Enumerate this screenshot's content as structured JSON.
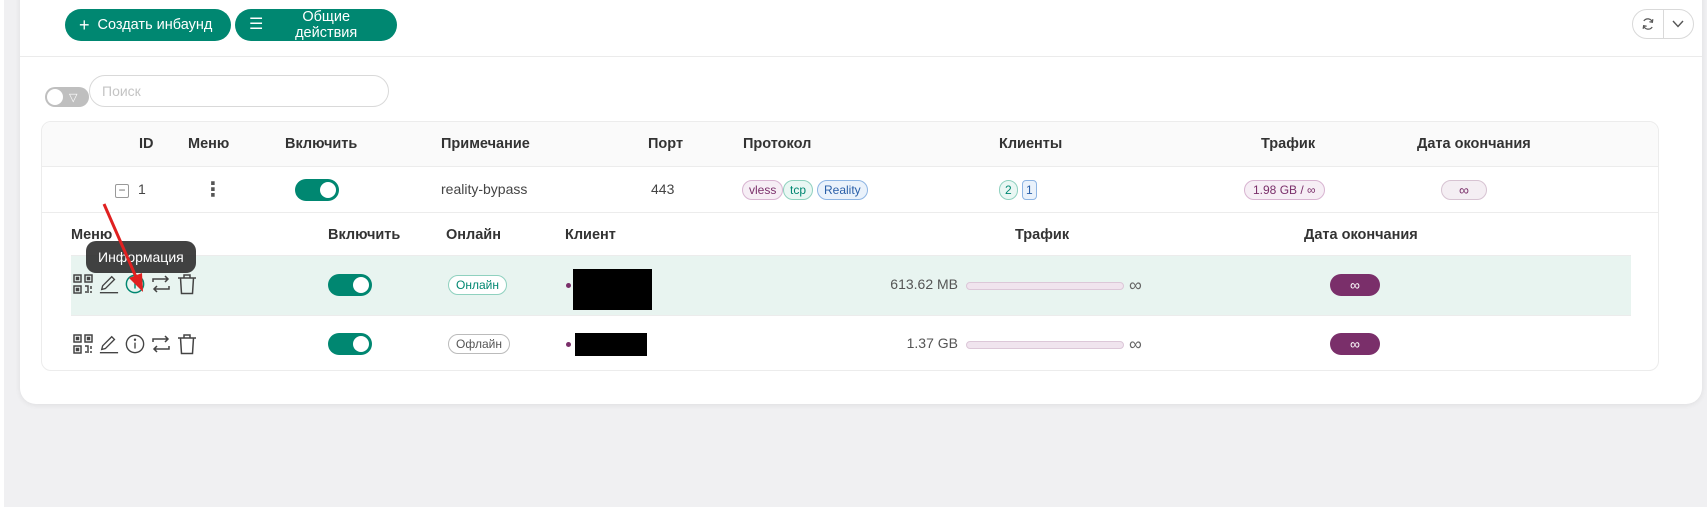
{
  "toolbar": {
    "create_label": "Создать инбаунд",
    "actions_label": "Общие действия"
  },
  "search": {
    "placeholder": "Поиск",
    "value": ""
  },
  "table": {
    "headers": {
      "id": "ID",
      "menu": "Меню",
      "enable": "Включить",
      "remark": "Примечание",
      "port": "Порт",
      "protocol": "Протокол",
      "clients": "Клиенты",
      "traffic": "Трафик",
      "expiry": "Дата окончания"
    },
    "rows": [
      {
        "id": "1",
        "remark": "reality-bypass",
        "port": "443",
        "protocol_tags": [
          "vless",
          "tcp",
          "Reality"
        ],
        "clients_total": "2",
        "clients_online": "1",
        "traffic": "1.98 GB / ∞",
        "expiry": "∞",
        "enabled": true
      }
    ]
  },
  "clients_table": {
    "headers": {
      "menu": "Меню",
      "enable": "Включить",
      "online": "Онлайн",
      "client": "Клиент",
      "traffic": "Трафик",
      "expiry": "Дата окончания"
    },
    "rows": [
      {
        "enabled": true,
        "status": "Онлайн",
        "traffic": "613.62 MB",
        "traffic_limit": "∞",
        "expiry": "∞"
      },
      {
        "enabled": true,
        "status": "Офлайн",
        "traffic": "1.37 GB",
        "traffic_limit": "∞",
        "expiry": "∞"
      }
    ]
  },
  "tooltip": {
    "text": "Информация"
  },
  "colors": {
    "primary": "#008771",
    "accent_purple": "#7a2f6a",
    "annotation_arrow": "#e02020"
  }
}
